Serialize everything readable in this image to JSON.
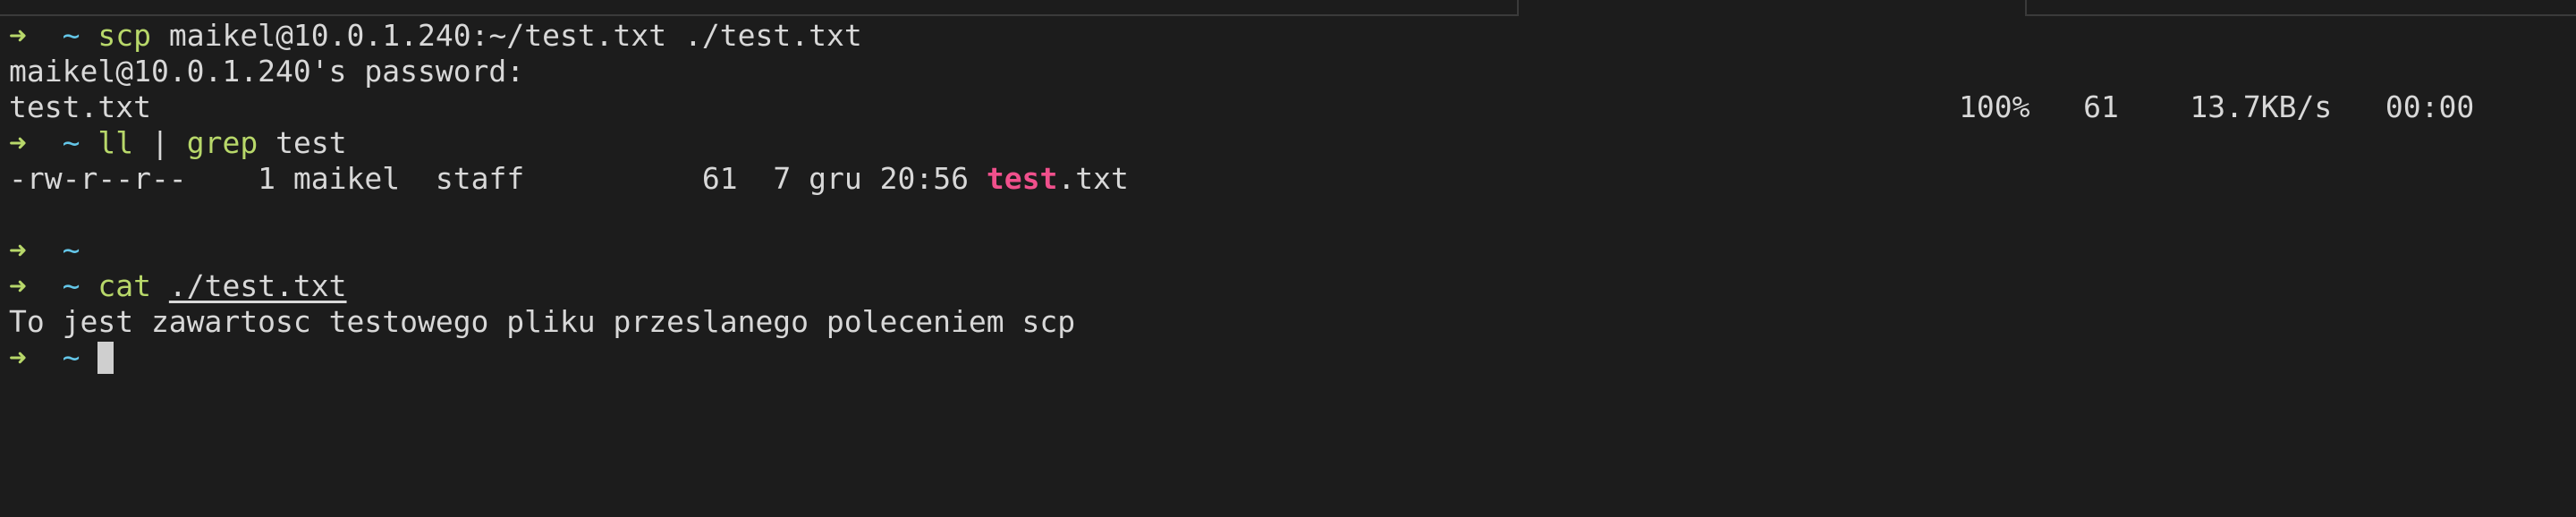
{
  "terminal": {
    "prompt_arrow": "➜",
    "prompt_dir": "~",
    "lines": {
      "l1": {
        "cmd": "scp",
        "args": "maikel@10.0.1.240:~/test.txt ./test.txt"
      },
      "l2": {
        "text": "maikel@10.0.1.240's password:"
      },
      "l3": {
        "file": "test.txt",
        "percent": "100%",
        "size": "61",
        "speed": "13.7KB/s",
        "eta": "00:00"
      },
      "l4": {
        "cmd": "ll",
        "pipe": "|",
        "cmd2": "grep",
        "args": "test"
      },
      "l5": {
        "perms": "-rw-r--r--",
        "links": "1",
        "owner": "maikel",
        "group": "staff",
        "size": "61",
        "day": "7",
        "month": "gru",
        "time": "20:56",
        "name_match": "test",
        "name_rest": ".txt"
      },
      "l8": {
        "cmd": "cat",
        "args": "./test.txt"
      },
      "l9": {
        "text": "To jest zawartosc testowego pliku przeslanego poleceniem scp"
      }
    }
  }
}
